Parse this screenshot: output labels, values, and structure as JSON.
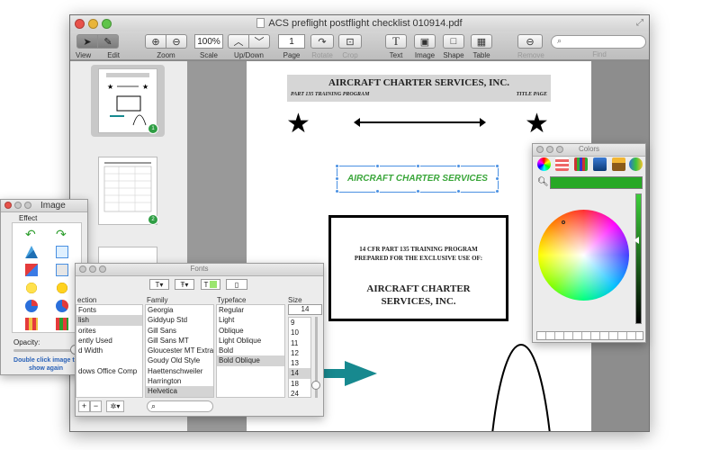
{
  "window": {
    "title": "ACS preflight postflight checklist 010914.pdf"
  },
  "toolbar": {
    "view_label": "View",
    "edit_label": "Edit",
    "zoom_label": "Zoom",
    "scale_value": "100%",
    "scale_label": "Scale",
    "updown_label": "Up/Down",
    "page_value": "1",
    "page_label": "Page",
    "rotate_label": "Rotate",
    "crop_label": "Crop",
    "text_label": "Text",
    "image_label": "Image",
    "shape_label": "Shape",
    "table_label": "Table",
    "remove_label": "Remove",
    "find_label": "Find"
  },
  "document": {
    "company_header": "AIRCRAFT CHARTER SERVICES, INC.",
    "program_label": "PART 135 TRAINING PROGRAM",
    "title_page_label": "TITLE PAGE",
    "selected_text": "AIRCRAFT CHARTER SERVICES",
    "frame_line1": "14 CFR PART 135 TRAINING PROGRAM",
    "frame_line2": "PREPARED FOR THE EXCLUSIVE USE OF:",
    "frame_big1": "AIRCRAFT CHARTER",
    "frame_big2": "SERVICES, INC."
  },
  "thumbnails": [
    {
      "badge": "1"
    },
    {
      "badge": "2"
    }
  ],
  "image_panel": {
    "title": "Image",
    "effect_label": "Effect",
    "opacity_label": "Opacity:",
    "opacity": 1.0,
    "hint": "Double click image to show again"
  },
  "fonts_panel": {
    "title": "Fonts",
    "headers": {
      "collection": "ection",
      "family": "Family",
      "typeface": "Typeface",
      "size": "Size"
    },
    "collections": [
      {
        "label": "Fonts",
        "selected": false
      },
      {
        "label": "lish",
        "selected": true
      },
      {
        "label": "orites",
        "selected": false
      },
      {
        "label": "ently Used",
        "selected": false
      },
      {
        "label": "d Width",
        "selected": false
      },
      {
        "label": "",
        "selected": false
      },
      {
        "label": "dows Office Comp",
        "selected": false
      }
    ],
    "families": [
      {
        "label": "Georgia",
        "selected": false
      },
      {
        "label": "Giddyup Std",
        "selected": false
      },
      {
        "label": "Gill Sans",
        "selected": false
      },
      {
        "label": "Gill Sans MT",
        "selected": false
      },
      {
        "label": "Gloucester MT Extra C",
        "selected": false
      },
      {
        "label": "Goudy Old Style",
        "selected": false
      },
      {
        "label": "Haettenschweiler",
        "selected": false
      },
      {
        "label": "Harrington",
        "selected": false
      },
      {
        "label": "Helvetica",
        "selected": true
      }
    ],
    "typefaces": [
      {
        "label": "Regular",
        "selected": false
      },
      {
        "label": "Light",
        "selected": false
      },
      {
        "label": "Oblique",
        "selected": false
      },
      {
        "label": "Light Oblique",
        "selected": false
      },
      {
        "label": "Bold",
        "selected": false
      },
      {
        "label": "Bold Oblique",
        "selected": true
      }
    ],
    "size_value": "14",
    "sizes": [
      {
        "label": "9",
        "selected": false
      },
      {
        "label": "10",
        "selected": false
      },
      {
        "label": "11",
        "selected": false
      },
      {
        "label": "12",
        "selected": false
      },
      {
        "label": "13",
        "selected": false
      },
      {
        "label": "14",
        "selected": true
      },
      {
        "label": "18",
        "selected": false
      },
      {
        "label": "24",
        "selected": false
      }
    ],
    "add_label": "+",
    "remove_label": "−",
    "action_label": "✲▾"
  },
  "colors_panel": {
    "title": "Colors",
    "selected_color": "#27a825"
  }
}
